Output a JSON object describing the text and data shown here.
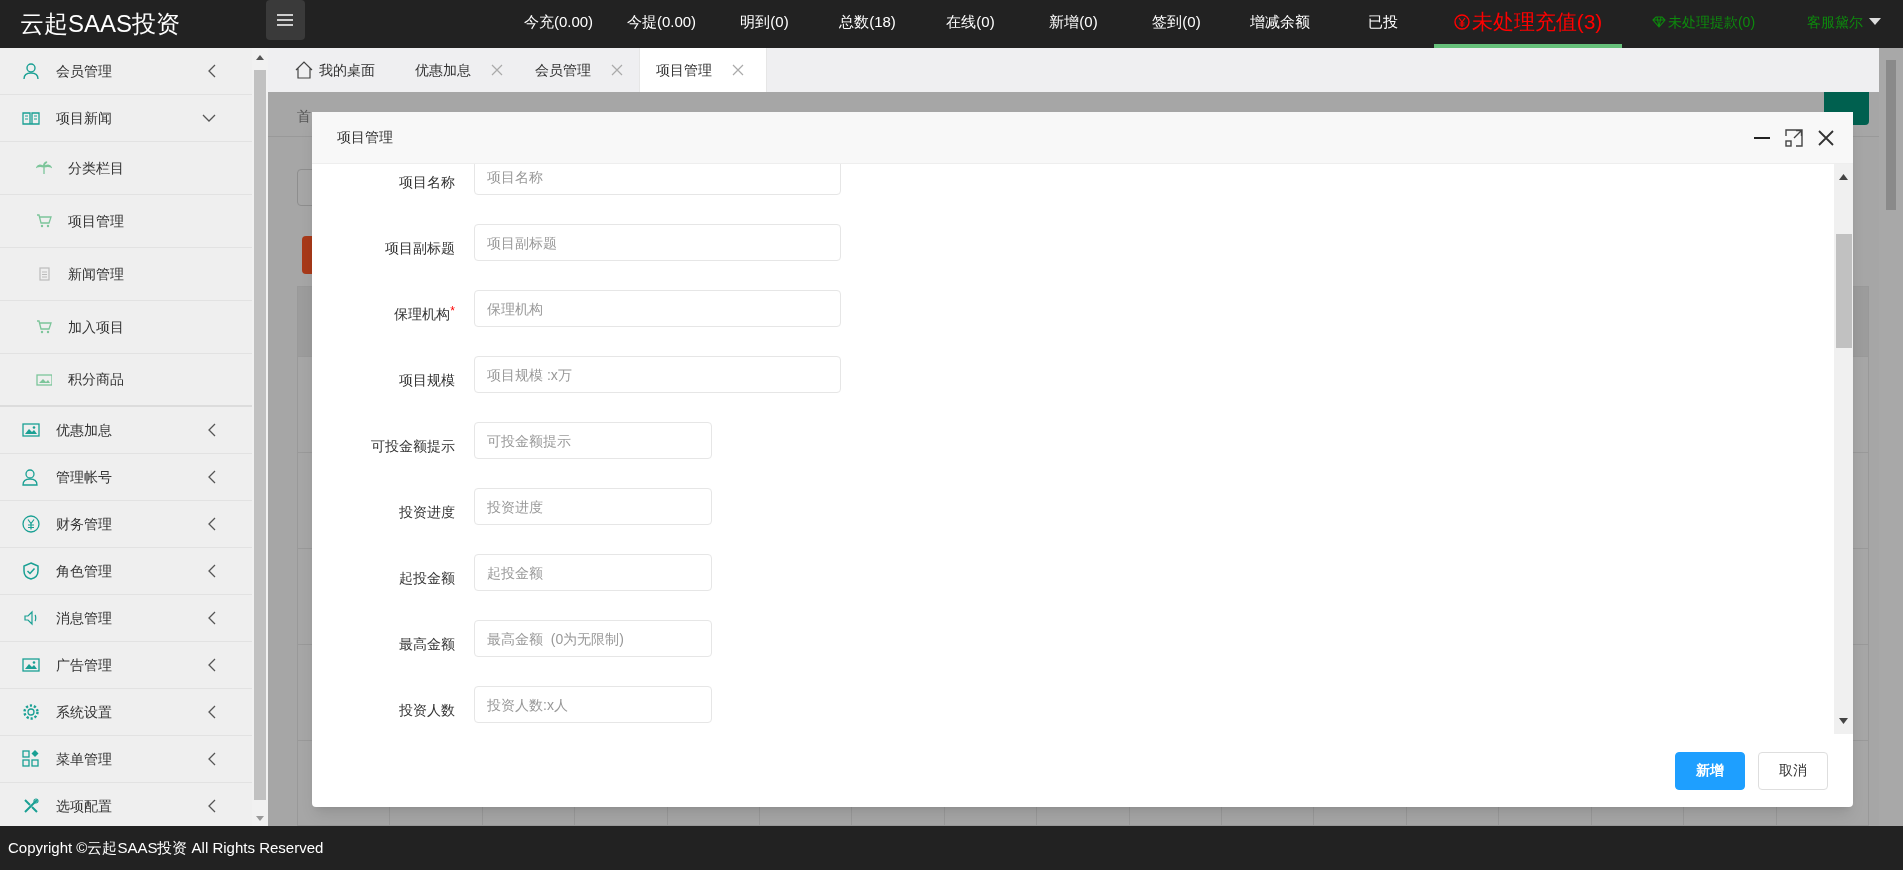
{
  "header": {
    "logo": "云起SAAS投资",
    "stats": [
      {
        "label": "今充(0.00)",
        "kind": "plain",
        "selected": false
      },
      {
        "label": "今提(0.00)",
        "kind": "plain",
        "selected": false
      },
      {
        "label": "明到(0)",
        "kind": "plain",
        "selected": false
      },
      {
        "label": "总数(18)",
        "kind": "plain",
        "selected": false
      },
      {
        "label": "在线(0)",
        "kind": "plain",
        "selected": false
      },
      {
        "label": "新增(0)",
        "kind": "plain",
        "selected": false
      },
      {
        "label": "签到(0)",
        "kind": "plain",
        "selected": false
      },
      {
        "label": "增减余额",
        "kind": "plain",
        "selected": false
      },
      {
        "label": "已投",
        "kind": "plain",
        "selected": false
      },
      {
        "label": "未处理充值(3)",
        "kind": "alert",
        "selected": true
      },
      {
        "label": "未处理提款(0)",
        "kind": "notice",
        "selected": false
      }
    ],
    "user": "客服黛尔"
  },
  "sidebar": {
    "items": [
      {
        "label": "会员管理",
        "expanded": false
      },
      {
        "label": "项目新闻",
        "expanded": true,
        "children": [
          {
            "label": "分类栏目"
          },
          {
            "label": "项目管理"
          },
          {
            "label": "新闻管理"
          },
          {
            "label": "加入项目"
          },
          {
            "label": "积分商品"
          }
        ]
      },
      {
        "label": "优惠加息",
        "expanded": false
      },
      {
        "label": "管理帐号",
        "expanded": false
      },
      {
        "label": "财务管理",
        "expanded": false
      },
      {
        "label": "角色管理",
        "expanded": false
      },
      {
        "label": "消息管理",
        "expanded": false
      },
      {
        "label": "广告管理",
        "expanded": false
      },
      {
        "label": "系统设置",
        "expanded": false
      },
      {
        "label": "菜单管理",
        "expanded": false
      },
      {
        "label": "选项配置",
        "expanded": false
      }
    ]
  },
  "tabs": [
    {
      "label": "我的桌面",
      "kind": "home",
      "closable": false,
      "selected": false
    },
    {
      "label": "优惠加息",
      "kind": "page",
      "closable": true,
      "selected": false
    },
    {
      "label": "会员管理",
      "kind": "page",
      "closable": true,
      "selected": false
    },
    {
      "label": "项目管理",
      "kind": "page",
      "closable": true,
      "selected": true
    }
  ],
  "background": {
    "breadcrumb": "首"
  },
  "modal": {
    "title": "项目管理",
    "fields": [
      {
        "label": "项目名称",
        "placeholder": "项目名称",
        "kind": "long"
      },
      {
        "label": "项目副标题",
        "placeholder": "项目副标题",
        "kind": "long"
      },
      {
        "label": "保理机构",
        "required_mark": "*",
        "placeholder": "保理机构",
        "kind": "long"
      },
      {
        "label": "项目规模",
        "placeholder": "项目规模 :x万",
        "kind": "long"
      },
      {
        "label": "可投金额提示",
        "placeholder": "可投金额提示",
        "kind": "short"
      },
      {
        "label": "投资进度",
        "placeholder": "投资进度",
        "kind": "short"
      },
      {
        "label": "起投金额",
        "placeholder": "起投金额",
        "kind": "short"
      },
      {
        "label": "最高金额",
        "placeholder": "最高金额  (0为无限制)",
        "kind": "short"
      },
      {
        "label": "投资人数",
        "placeholder": "投资人数:x人",
        "kind": "short"
      }
    ],
    "buttons": [
      {
        "label": "新增",
        "kind": "primary"
      },
      {
        "label": "取消",
        "kind": "default"
      }
    ]
  },
  "footer": {
    "copyright": "Copyright ©云起SAAS投资 All Rights Reserved"
  }
}
